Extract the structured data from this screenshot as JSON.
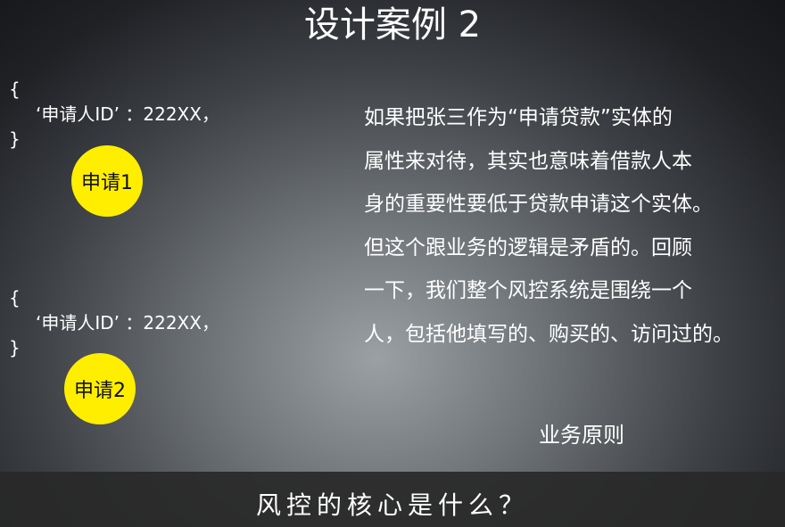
{
  "slide": {
    "title": "设计案例 2"
  },
  "code_blocks": [
    {
      "open": "{",
      "line": "‘申请人ID’ ：222XX，",
      "close": "}"
    },
    {
      "open": "{",
      "line": "‘申请人ID’ ：222XX，",
      "close": "}"
    }
  ],
  "badges": [
    {
      "label": "申请1"
    },
    {
      "label": "申请2"
    }
  ],
  "body_lines": [
    "如果把张三作为“申请贷款”实体的",
    "属性来对待，其实也意味着借款人本",
    "身的重要性要低于贷款申请这个实体。",
    "但这个跟业务的逻辑是矛盾的。回顾",
    "一下，我们整个风控系统是围绕一个",
    "人，包括他填写的、购买的、访问过的。"
  ],
  "principle_label": "业务原则",
  "subtitle": "风控的核心是什么？",
  "colors": {
    "badge_fill": "#ffee00",
    "text": "#ffffff",
    "subtitle_bar": "#282828"
  }
}
